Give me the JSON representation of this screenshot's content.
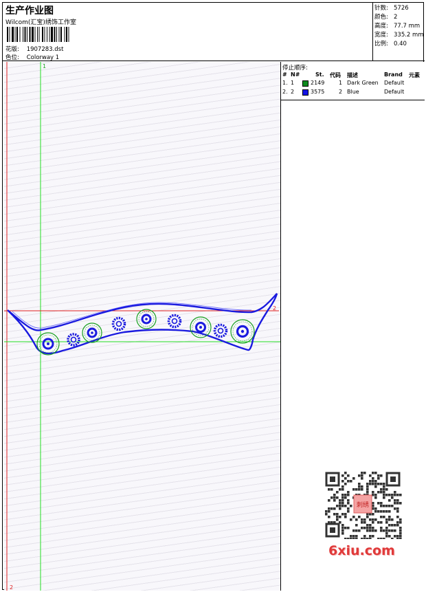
{
  "header": {
    "title": "生产作业图",
    "company": "Wilcom(汇宝)绣饰工作室",
    "design_label": "花版:",
    "design_value": "1907283.dst",
    "colorway_label": "色位:",
    "colorway_value": "Colorway 1"
  },
  "stats": [
    {
      "label": "针数:",
      "value": "5726"
    },
    {
      "label": "颜色:",
      "value": "2"
    },
    {
      "label": "高度:",
      "value": "77.7 mm"
    },
    {
      "label": "宽度:",
      "value": "335.2 mm"
    },
    {
      "label": "比例:",
      "value": "0.40"
    }
  ],
  "stop_sequence": {
    "title": "停止顺序:",
    "columns": [
      "#",
      "N#",
      "St.",
      "代码",
      "描述",
      "Brand",
      "元素"
    ],
    "rows": [
      {
        "idx": "1.",
        "n": "1",
        "st": "2149",
        "code": "1",
        "desc": "Dark Green",
        "brand": "Default",
        "color": "#0f8a1e"
      },
      {
        "idx": "2.",
        "n": "2",
        "st": "3575",
        "code": "2",
        "desc": "Blue",
        "brand": "Default",
        "color": "#1414e6"
      }
    ]
  },
  "markers": {
    "green_v": "1",
    "red_h": "2",
    "red_v": "2"
  },
  "colors": {
    "thread_blue": "#1a1adf",
    "thread_green": "#18a11e",
    "guide_green": "#22dd22",
    "guide_red": "#e02020"
  },
  "watermark": {
    "logo_text": "6xiu.com",
    "seal_text": "刺绣"
  }
}
